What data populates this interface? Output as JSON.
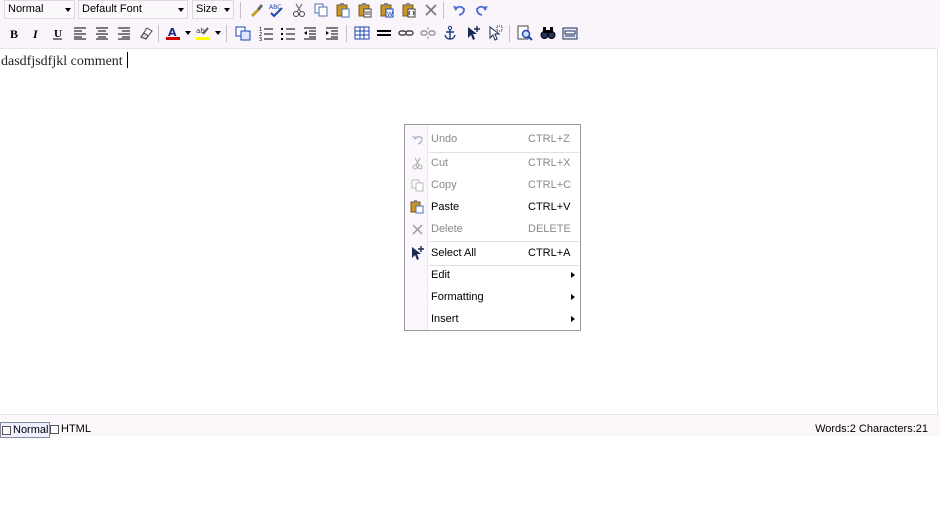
{
  "toolbar": {
    "format_select": "Normal",
    "font_select": "Default Font",
    "size_select": "Size",
    "row1_icons": [
      "format-brush-icon",
      "spellcheck-icon",
      "cut-icon",
      "copy-icon",
      "paste-icon",
      "paste-text-icon",
      "paste-word-icon",
      "paste-html-icon",
      "delete-icon",
      "undo-icon",
      "redo-icon"
    ],
    "row2_icons": [
      "bold-icon",
      "italic-icon",
      "underline-icon",
      "align-left-icon",
      "align-center-icon",
      "align-right-icon",
      "eraser-icon",
      "font-color-icon",
      "highlight-color-icon",
      "insert-snippet-icon",
      "ordered-list-icon",
      "unordered-list-icon",
      "outdent-icon",
      "indent-icon",
      "table-icon",
      "horizontal-rule-icon",
      "link-icon",
      "unlink-icon",
      "anchor-icon",
      "select-all-icon",
      "select-icon",
      "preview-icon",
      "find-icon",
      "form-icon"
    ],
    "font_color": "#d40000",
    "highlight_color": "#ffff00"
  },
  "editor": {
    "content": "dasdfjsdfjkl comment"
  },
  "statusbar": {
    "mode_normal": "Normal",
    "mode_html": "HTML",
    "counter": "Words:2 Characters:21"
  },
  "context_menu": {
    "items": [
      {
        "label": "Undo",
        "shortcut": "CTRL+Z",
        "icon": "undo-icon",
        "enabled": false
      },
      {
        "label": "Cut",
        "shortcut": "CTRL+X",
        "icon": "cut-icon",
        "enabled": false
      },
      {
        "label": "Copy",
        "shortcut": "CTRL+C",
        "icon": "copy-icon",
        "enabled": false
      },
      {
        "label": "Paste",
        "shortcut": "CTRL+V",
        "icon": "paste-icon",
        "enabled": true
      },
      {
        "label": "Delete",
        "shortcut": "DELETE",
        "icon": "delete-icon",
        "enabled": false
      },
      {
        "label": "Select All",
        "shortcut": "CTRL+A",
        "icon": "select-all-icon",
        "enabled": true
      },
      {
        "label": "Edit",
        "shortcut": "",
        "icon": "",
        "enabled": true,
        "submenu": true
      },
      {
        "label": "Formatting",
        "shortcut": "",
        "icon": "",
        "enabled": true,
        "submenu": true
      },
      {
        "label": "Insert",
        "shortcut": "",
        "icon": "",
        "enabled": true,
        "submenu": true
      }
    ]
  }
}
